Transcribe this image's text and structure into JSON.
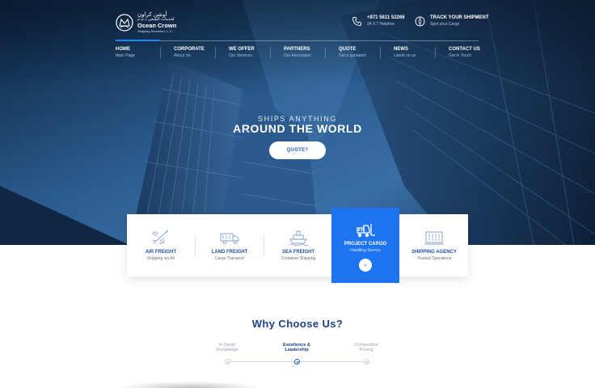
{
  "brand": {
    "arabic_name": "أوشن كراون",
    "arabic_sub": "لخدمات الشحن ذ.م.م",
    "name": "Ocean Crown",
    "sub": "Shipping Services L.L.C."
  },
  "contact": {
    "phone": "+971 5611 52266",
    "phone_sub": "24 X 7 Helpline",
    "track": "TRACK YOUR SHIPMENT",
    "track_sub": "Spot your Cargo"
  },
  "nav": [
    {
      "title": "HOME",
      "sub": "Main Page"
    },
    {
      "title": "CORPORATE",
      "sub": "About Us"
    },
    {
      "title": "WE OFFER",
      "sub": "Our Services"
    },
    {
      "title": "PARTNERS",
      "sub": "Our Associates"
    },
    {
      "title": "QUOTE",
      "sub": "Get a quotation"
    },
    {
      "title": "NEWS",
      "sub": "Latest on us"
    },
    {
      "title": "CONTACT US",
      "sub": "Get in Touch"
    }
  ],
  "hero": {
    "tagline_small": "SHIPS ANYTHING",
    "tagline_big": "AROUND THE WORLD",
    "cta": "QUOTE?"
  },
  "services": [
    {
      "title": "AIR FREIGHT",
      "sub": "Shipping via Air",
      "icon": "airplane-icon"
    },
    {
      "title": "LAND FREIGHT",
      "sub": "Cargo Transport",
      "icon": "truck-icon"
    },
    {
      "title": "SEA FREIGHT",
      "sub": "Container Shipping",
      "icon": "ship-icon"
    },
    {
      "title": "PROJECT CARGO",
      "sub": "Handling Service",
      "icon": "forklift-icon"
    },
    {
      "title": "SHIPPING AGENCY",
      "sub": "Trusted Operations",
      "icon": "container-icon"
    }
  ],
  "why": {
    "title": "Why Choose Us?",
    "items": [
      {
        "label_1": "In-Depth",
        "label_2": "Knowledge"
      },
      {
        "label_1": "Excellence &",
        "label_2": "Leadership"
      },
      {
        "label_1": "Competitive",
        "label_2": "Pricing"
      }
    ]
  },
  "colors": {
    "accent": "#1e73f0",
    "brand_dark": "#1c3f8c",
    "hero_dark": "#0d2440"
  }
}
